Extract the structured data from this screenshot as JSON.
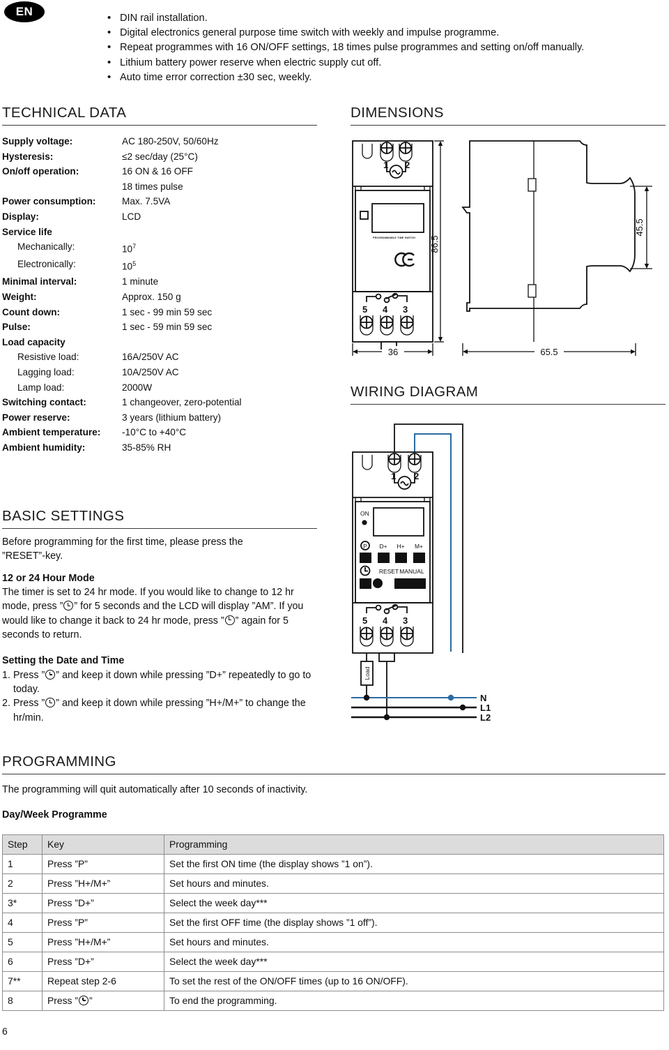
{
  "language_badge": "EN",
  "features": [
    "DIN rail installation.",
    "Digital electronics general purpose time switch with weekly and impulse programme.",
    "Repeat programmes with 16 ON/OFF settings, 18 times pulse programmes and setting on/off manually.",
    "Lithium battery power reserve when electric supply cut off.",
    "Auto time error correction ±30 sec, weekly."
  ],
  "technical_data": {
    "heading": "TECHNICAL DATA",
    "rows": [
      {
        "key": "Supply voltage:",
        "value": "AC 180-250V, 50/60Hz",
        "indent": false
      },
      {
        "key": "Hysteresis:",
        "value": "≤2 sec/day (25°C)",
        "indent": false
      },
      {
        "key": "On/off operation:",
        "value": "16 ON & 16 OFF",
        "indent": false
      },
      {
        "key": "",
        "value": "18 times pulse",
        "indent": false
      },
      {
        "key": "Power consumption:",
        "value": "Max. 7.5VA",
        "indent": false
      },
      {
        "key": "Display:",
        "value": "LCD",
        "indent": false
      },
      {
        "key": "Service life",
        "value": "",
        "indent": false
      },
      {
        "key": "Mechanically:",
        "value": "10⁷",
        "indent": true
      },
      {
        "key": "Electronically:",
        "value": "10⁵",
        "indent": true
      },
      {
        "key": "Minimal interval:",
        "value": "1 minute",
        "indent": false
      },
      {
        "key": "Weight:",
        "value": "Approx. 150 g",
        "indent": false
      },
      {
        "key": "Count down:",
        "value": "1 sec - 99 min 59 sec",
        "indent": false
      },
      {
        "key": "Pulse:",
        "value": "1 sec - 59 min 59 sec",
        "indent": false
      },
      {
        "key": "Load capacity",
        "value": "",
        "indent": false
      },
      {
        "key": "Resistive load:",
        "value": "16A/250V AC",
        "indent": true
      },
      {
        "key": "Lagging load:",
        "value": "10A/250V AC",
        "indent": true
      },
      {
        "key": "Lamp load:",
        "value": "2000W",
        "indent": true
      },
      {
        "key": "Switching contact:",
        "value": "1 changeover, zero-potential",
        "indent": false
      },
      {
        "key": "Power reserve:",
        "value": "3 years (lithium battery)",
        "indent": false
      },
      {
        "key": "Ambient temperature:",
        "value": "-10°C to +40°C",
        "indent": false
      },
      {
        "key": "Ambient humidity:",
        "value": "35-85% RH",
        "indent": false
      }
    ]
  },
  "dimensions": {
    "heading": "DIMENSIONS",
    "height_mm": "86.5",
    "width_mm": "36",
    "depth_mm": "65.5",
    "front_depth_mm": "45.5",
    "front_terminals_top": [
      "1",
      "2"
    ],
    "front_terminals_bottom": [
      "5",
      "4",
      "3"
    ],
    "device_label": "PROGRAMMABLE TIME SWITCH",
    "certification_mark": "CE"
  },
  "wiring": {
    "heading": "WIRING DIAGRAM",
    "terminals_top": [
      "1",
      "2"
    ],
    "terminals_bottom": [
      "5",
      "4",
      "3"
    ],
    "indicator_label": "ON",
    "buttons_row1": [
      "P",
      "D+",
      "H+",
      "M+"
    ],
    "buttons_row2": [
      "RESET",
      "MANUAL"
    ],
    "load_label": "Load",
    "lines": [
      "N",
      "L1",
      "L2"
    ],
    "neutral_color": "#2b6ca3"
  },
  "basic_settings": {
    "heading": "BASIC SETTINGS",
    "intro_line1": "Before programming for the first time, please press the",
    "intro_line2": "”RESET”-key.",
    "mode_title": "12 or 24 Hour Mode",
    "mode_text_a": "The timer is set to 24 hr mode. If you would like to change to 12 hr mode, press ”",
    "mode_text_b": "” for 5 seconds and the LCD will display ”AM”. If you would like to change it back to 24 hr mode, press ”",
    "mode_text_c": "” again for 5 seconds to return.",
    "datetime_title": "Setting the Date and Time",
    "step1_num": "1.",
    "step1_a": "Press ”",
    "step1_b": "” and keep it down while pressing ”D+” repeatedly to go to today.",
    "step2_num": "2.",
    "step2_a": "Press ”",
    "step2_b": "” and keep it down while pressing ”H+/M+” to change the hr/min."
  },
  "programming": {
    "heading": "PROGRAMMING",
    "note": "The programming will quit automatically after 10 seconds of inactivity.",
    "subheading": "Day/Week Programme",
    "columns": [
      "Step",
      "Key",
      "Programming"
    ],
    "rows": [
      [
        "1",
        "Press ”P”",
        "Set the first ON time (the display shows ”1 on”)."
      ],
      [
        "2",
        "Press ”H+/M+”",
        "Set hours and minutes."
      ],
      [
        "3*",
        "Press ”D+”",
        "Select the week day***"
      ],
      [
        "4",
        "Press ”P”",
        "Set the first OFF time (the display shows ”1 off”)."
      ],
      [
        "5",
        "Press ”H+/M+”",
        "Set hours and minutes."
      ],
      [
        "6",
        "Press ”D+”",
        "Select the week day***"
      ],
      [
        "7**",
        "Repeat step 2-6",
        "To set the rest of the ON/OFF times (up to 16 ON/OFF)."
      ],
      [
        "8",
        "Press ”⊕”",
        "To end the programming."
      ]
    ],
    "row8_key_prefix": "Press ”",
    "row8_key_suffix": "”"
  },
  "page_number": "6"
}
